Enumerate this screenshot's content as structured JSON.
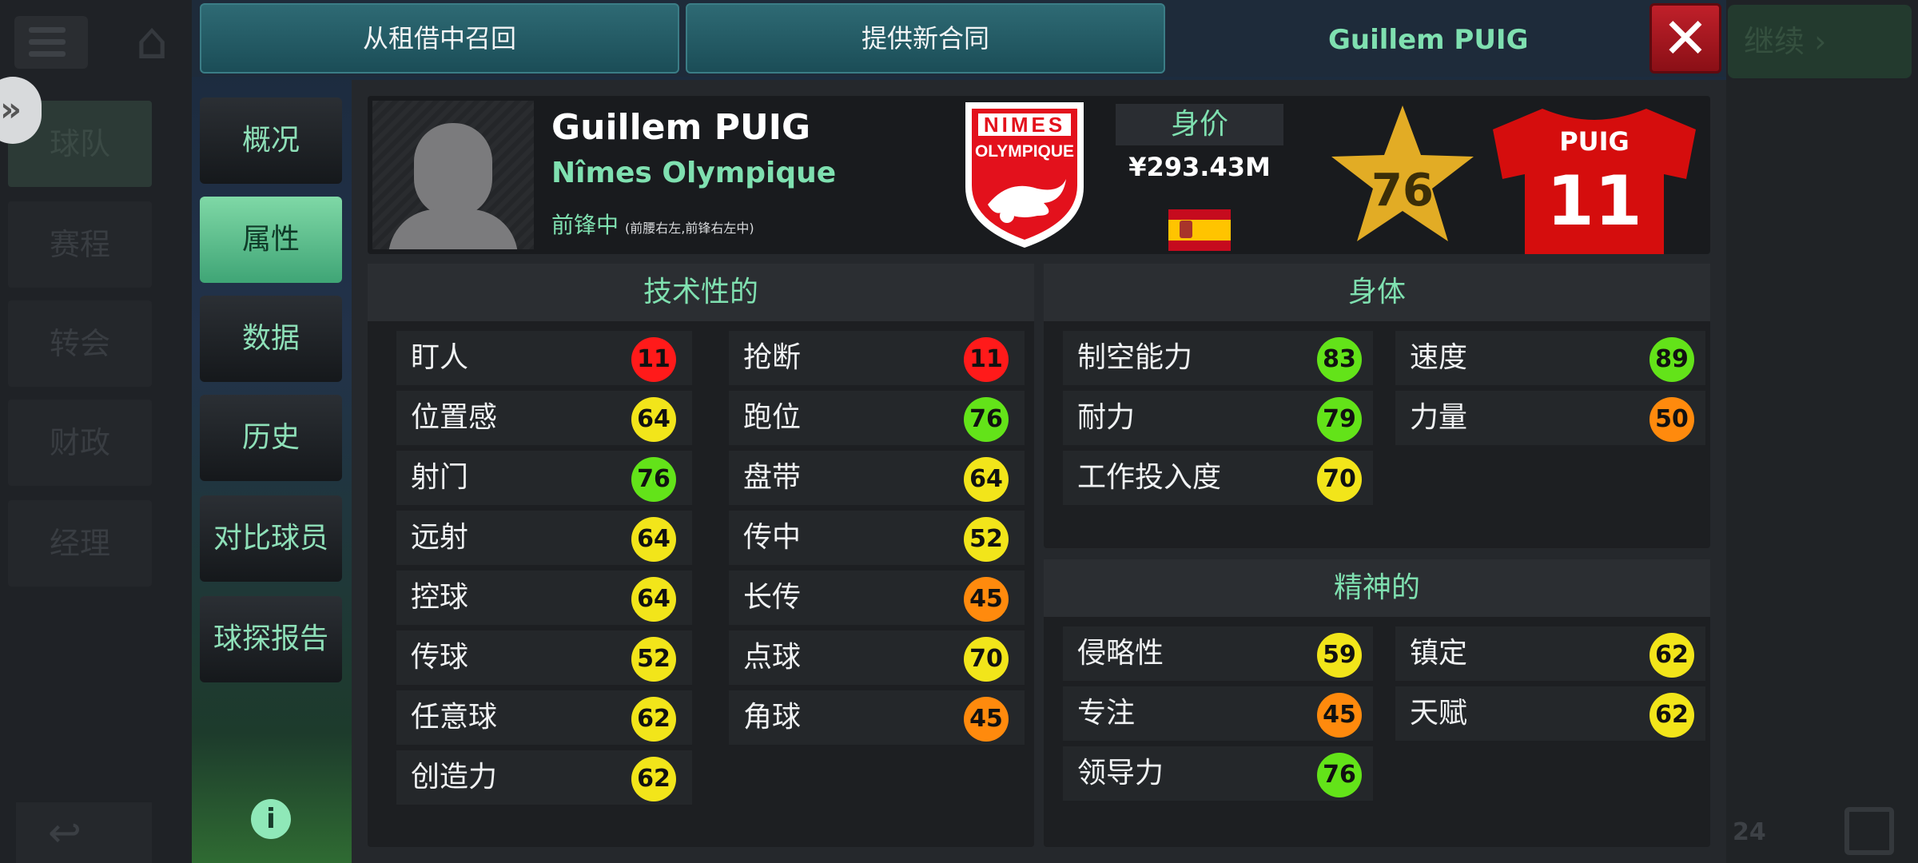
{
  "background": {
    "nav": [
      "球队",
      "赛程",
      "转会",
      "财政",
      "经理"
    ],
    "continue_label": "继续",
    "page_num": "24"
  },
  "top": {
    "recall_label": "从租借中召回",
    "offer_label": "提供新合同",
    "title": "Guillem PUIG",
    "close_label": "✕"
  },
  "tabs": [
    "概况",
    "属性",
    "数据",
    "历史",
    "对比球员",
    "球探报告"
  ],
  "active_tab": "属性",
  "player": {
    "name": "Guillem PUIG",
    "club": "Nîmes Olympique",
    "position": "前锋中",
    "positions_detail": "(前腰右左,前锋右左中)",
    "value_label": "身价",
    "value": "¥293.43M",
    "rating": "76",
    "shirt_name": "PUIG",
    "shirt_number": "11",
    "crest_text": [
      "NIMES",
      "OLYMPIQUE"
    ]
  },
  "colors": {
    "red": "#ff1a1a",
    "yellow": "#f2e51a",
    "green": "#63e319",
    "orange": "#ff8a0d",
    "accent": "#7fe0b0"
  },
  "technical": {
    "title": "技术性的",
    "col1": [
      {
        "label": "盯人",
        "value": "11",
        "color": "red"
      },
      {
        "label": "位置感",
        "value": "64",
        "color": "yellow"
      },
      {
        "label": "射门",
        "value": "76",
        "color": "green"
      },
      {
        "label": "远射",
        "value": "64",
        "color": "yellow"
      },
      {
        "label": "控球",
        "value": "64",
        "color": "yellow"
      },
      {
        "label": "传球",
        "value": "52",
        "color": "yellow"
      },
      {
        "label": "任意球",
        "value": "62",
        "color": "yellow"
      },
      {
        "label": "创造力",
        "value": "62",
        "color": "yellow"
      }
    ],
    "col2": [
      {
        "label": "抢断",
        "value": "11",
        "color": "red"
      },
      {
        "label": "跑位",
        "value": "76",
        "color": "green"
      },
      {
        "label": "盘带",
        "value": "64",
        "color": "yellow"
      },
      {
        "label": "传中",
        "value": "52",
        "color": "yellow"
      },
      {
        "label": "长传",
        "value": "45",
        "color": "orange"
      },
      {
        "label": "点球",
        "value": "70",
        "color": "yellow"
      },
      {
        "label": "角球",
        "value": "45",
        "color": "orange"
      }
    ]
  },
  "physical": {
    "title": "身体",
    "col1": [
      {
        "label": "制空能力",
        "value": "83",
        "color": "green"
      },
      {
        "label": "耐力",
        "value": "79",
        "color": "green"
      },
      {
        "label": "工作投入度",
        "value": "70",
        "color": "yellow"
      }
    ],
    "col2": [
      {
        "label": "速度",
        "value": "89",
        "color": "green"
      },
      {
        "label": "力量",
        "value": "50",
        "color": "orange"
      }
    ]
  },
  "mental": {
    "title": "精神的",
    "col1": [
      {
        "label": "侵略性",
        "value": "59",
        "color": "yellow"
      },
      {
        "label": "专注",
        "value": "45",
        "color": "orange"
      },
      {
        "label": "领导力",
        "value": "76",
        "color": "green"
      }
    ],
    "col2": [
      {
        "label": "镇定",
        "value": "62",
        "color": "yellow"
      },
      {
        "label": "天赋",
        "value": "62",
        "color": "yellow"
      }
    ]
  }
}
